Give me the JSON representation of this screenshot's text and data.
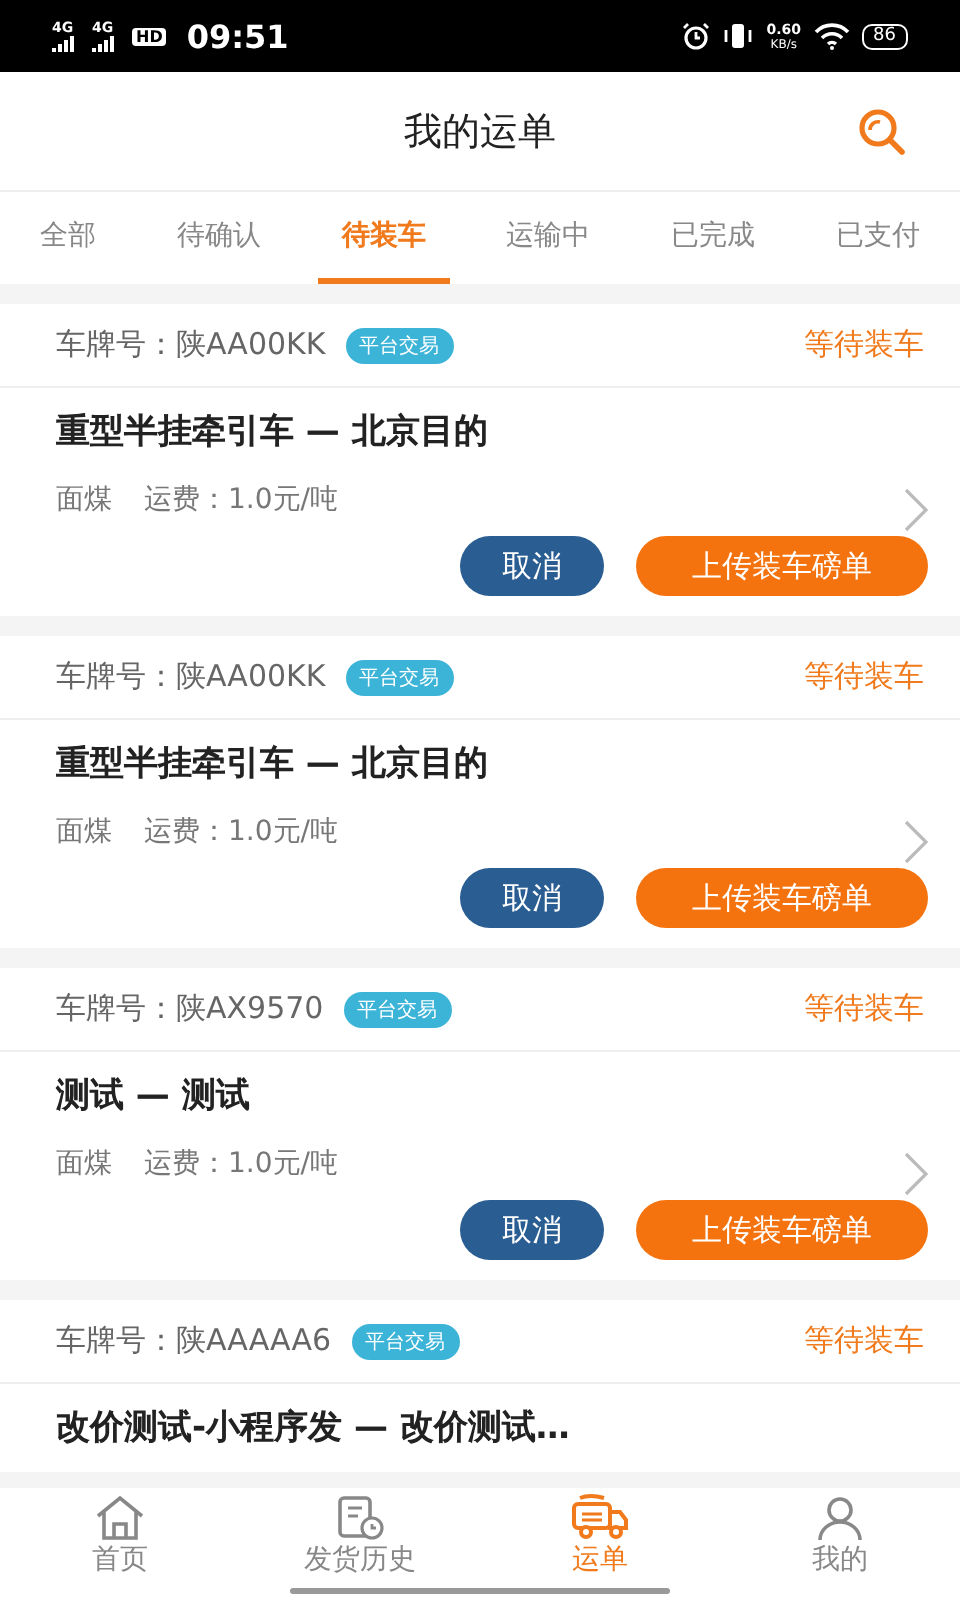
{
  "status_bar": {
    "network_labels": [
      "4G",
      "4G",
      "HD"
    ],
    "time": "09:51",
    "speed": "0.60",
    "speed_unit": "KB/s",
    "battery": "86"
  },
  "header": {
    "title": "我的运单"
  },
  "tabs": [
    {
      "label": "全部",
      "selected": false
    },
    {
      "label": "待确认",
      "selected": false
    },
    {
      "label": "待装车",
      "selected": true
    },
    {
      "label": "运输中",
      "selected": false
    },
    {
      "label": "已完成",
      "selected": false
    },
    {
      "label": "已支付",
      "selected": false
    }
  ],
  "orders": [
    {
      "plate_label": "车牌号：",
      "plate": "陕AA00KK",
      "tag": "平台交易",
      "status": "等待装车",
      "route": "重型半挂牵引车 — 北京目的",
      "cargo": "面煤",
      "fee": "运费：1.0元/吨",
      "buttons": [
        "取消",
        "上传装车磅单"
      ]
    },
    {
      "plate_label": "车牌号：",
      "plate": "陕AA00KK",
      "tag": "平台交易",
      "status": "等待装车",
      "route": "重型半挂牵引车 — 北京目的",
      "cargo": "面煤",
      "fee": "运费：1.0元/吨",
      "buttons": [
        "取消",
        "上传装车磅单"
      ]
    },
    {
      "plate_label": "车牌号：",
      "plate": "陕AX9570",
      "tag": "平台交易",
      "status": "等待装车",
      "route": "测试 — 测试",
      "cargo": "面煤",
      "fee": "运费：1.0元/吨",
      "buttons": [
        "取消",
        "上传装车磅单"
      ]
    },
    {
      "plate_label": "车牌号：",
      "plate": "陕AAAAA6",
      "tag": "平台交易",
      "status": "等待装车",
      "route": "改价测试-小程序发 — 改价测试…"
    }
  ],
  "bottom_nav": [
    {
      "label": "首页",
      "selected": false
    },
    {
      "label": "发货历史",
      "selected": false
    },
    {
      "label": "运单",
      "selected": true
    },
    {
      "label": "我的",
      "selected": false
    }
  ]
}
